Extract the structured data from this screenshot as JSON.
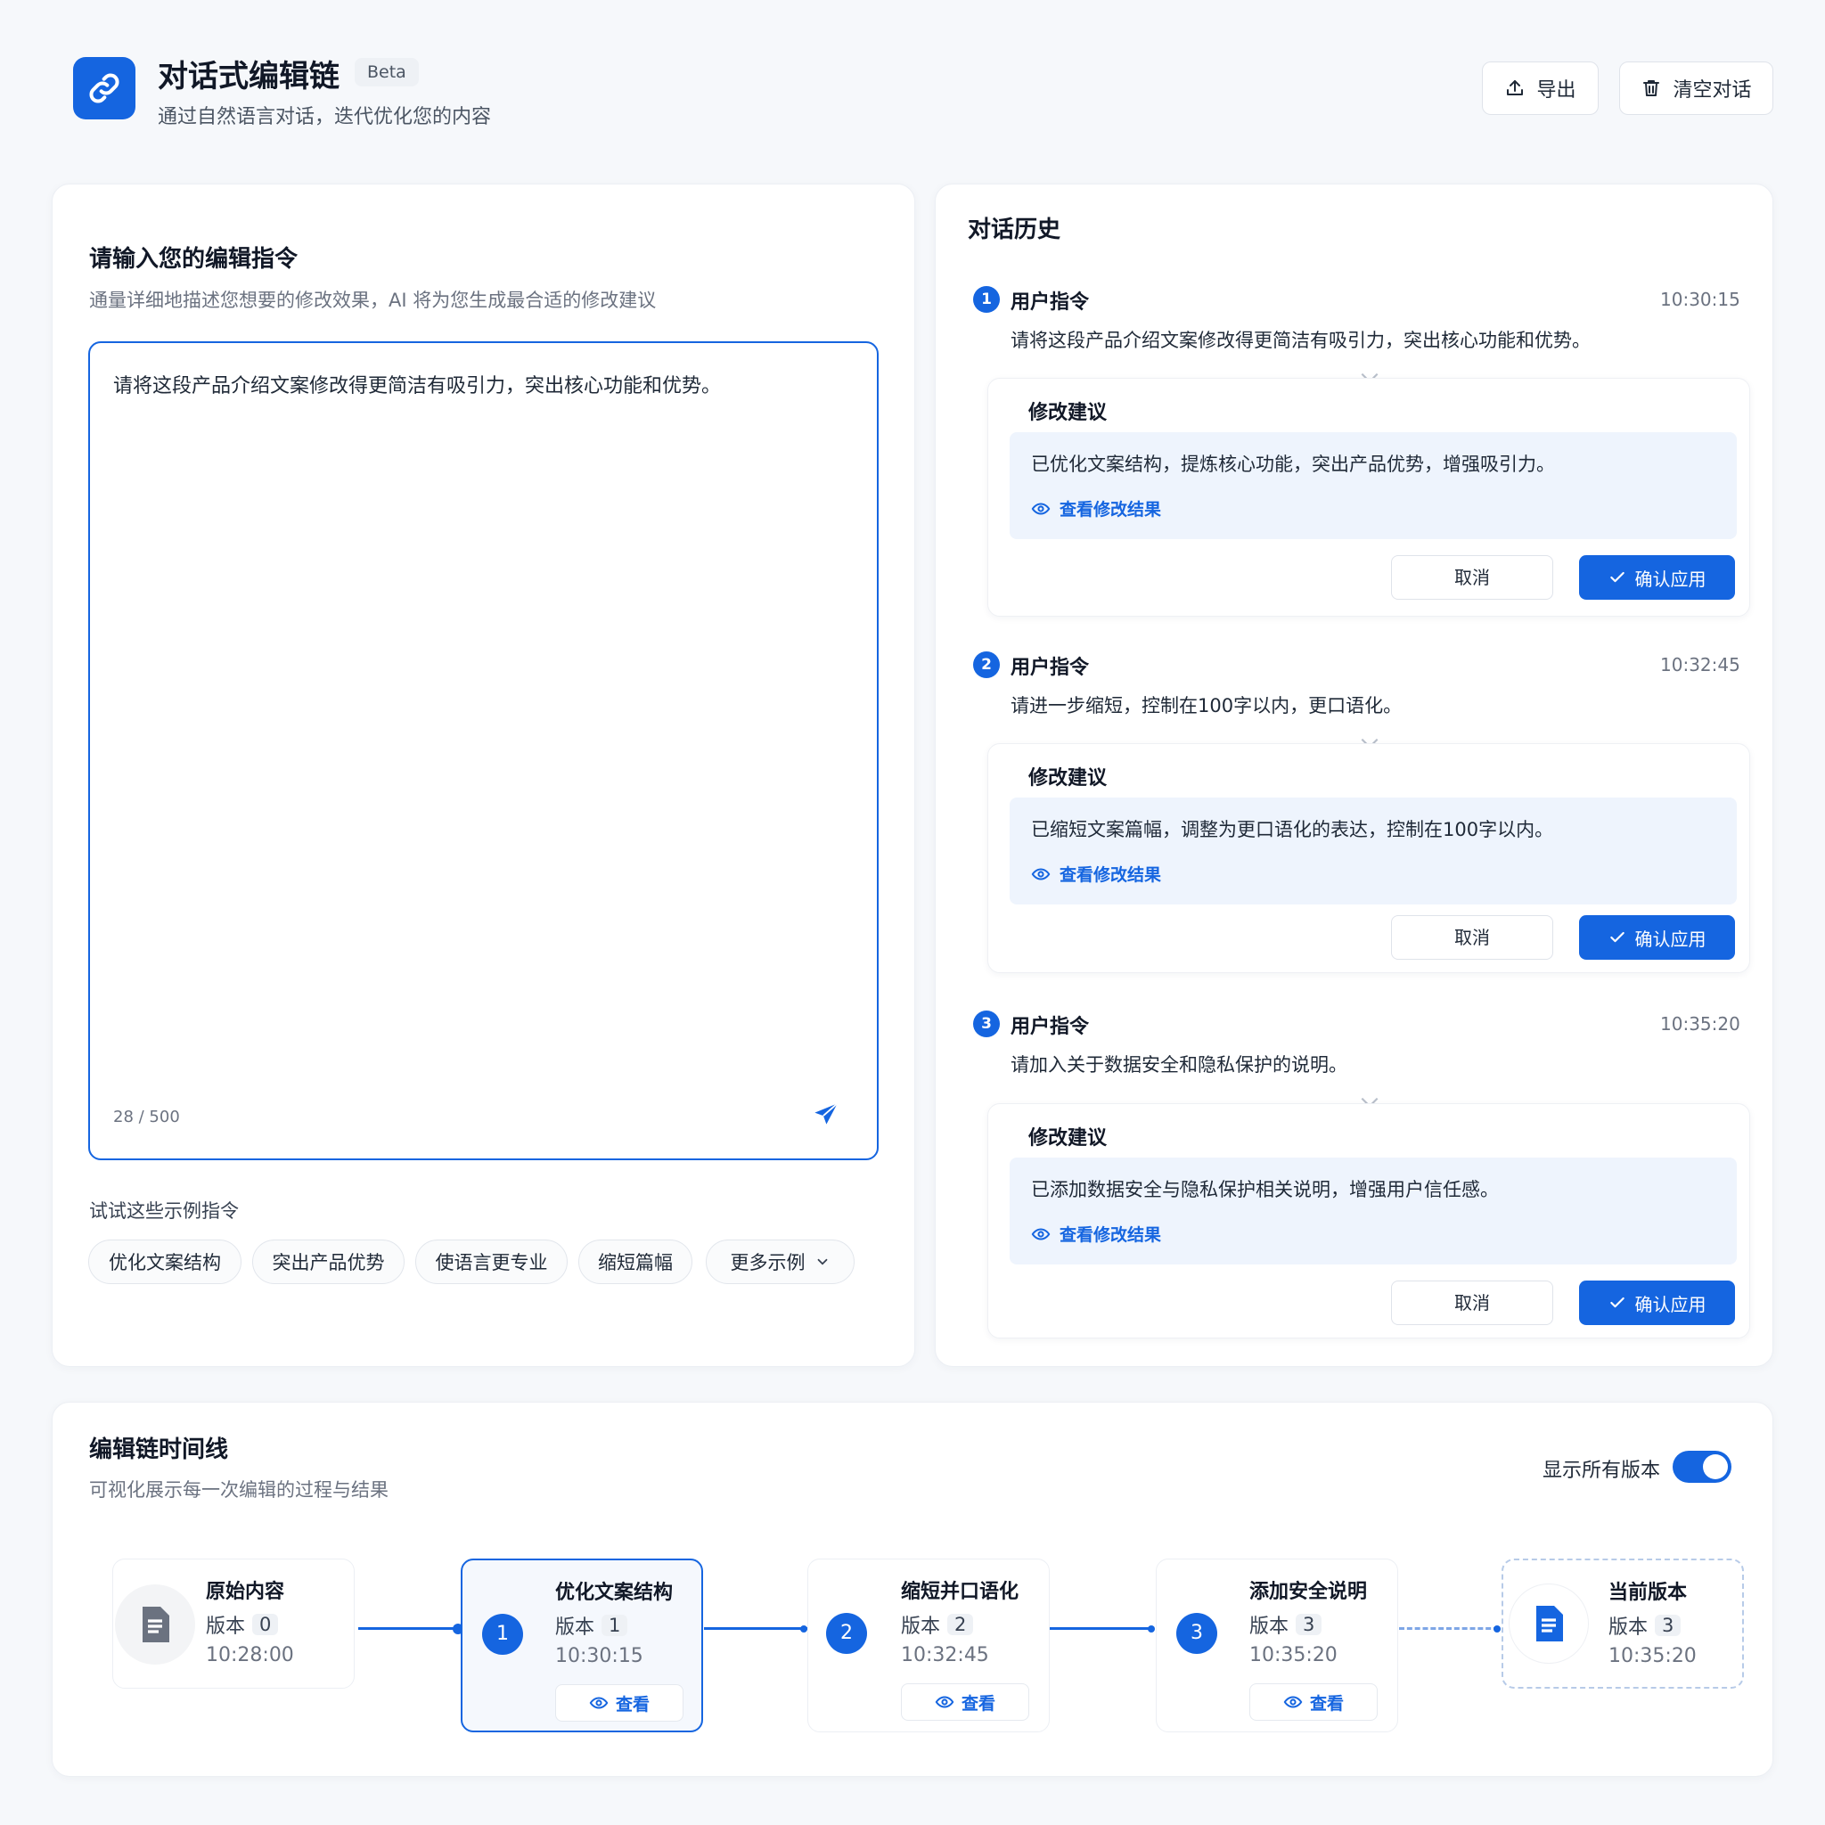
{
  "header": {
    "title": "对话式编辑链",
    "beta": "Beta",
    "subtitle": "通过自然语言对话，迭代优化您的内容",
    "export_label": "导出",
    "clear_label": "清空对话"
  },
  "input_panel": {
    "title": "请输入您的编辑指令",
    "subtitle": "通量详细地描述您想要的修改效果，AI 将为您生成最合适的修改建议",
    "text": "请将这段产品介绍文案修改得更简洁有吸引力，突出核心功能和优势。",
    "char_count": "28 / 500",
    "examples_label": "试试这些示例指令",
    "examples": [
      "优化文案结构",
      "突出产品优势",
      "使语言更专业",
      "缩短篇幅"
    ],
    "more_label": "更多示例"
  },
  "history": {
    "title": "对话历史",
    "items": [
      {
        "num": "1",
        "label": "用户指令",
        "time": "10:30:15",
        "command": "请将这段产品介绍文案修改得更简洁有吸引力，突出核心功能和优势。",
        "suggestion_title": "修改建议",
        "suggestion": "已优化文案结构，提炼核心功能，突出产品优势，增强吸引力。",
        "view_label": "查看修改结果",
        "cancel_label": "取消",
        "apply_label": "确认应用"
      },
      {
        "num": "2",
        "label": "用户指令",
        "time": "10:32:45",
        "command": "请进一步缩短，控制在100字以内，更口语化。",
        "suggestion_title": "修改建议",
        "suggestion": "已缩短文案篇幅，调整为更口语化的表达，控制在100字以内。",
        "view_label": "查看修改结果",
        "cancel_label": "取消",
        "apply_label": "确认应用"
      },
      {
        "num": "3",
        "label": "用户指令",
        "time": "10:35:20",
        "command": "请加入关于数据安全和隐私保护的说明。",
        "suggestion_title": "修改建议",
        "suggestion": "已添加数据安全与隐私保护相关说明，增强用户信任感。",
        "view_label": "查看修改结果",
        "cancel_label": "取消",
        "apply_label": "确认应用"
      }
    ]
  },
  "timeline": {
    "title": "编辑链时间线",
    "subtitle": "可视化展示每一次编辑的过程与结果",
    "toggle_label": "显示所有版本",
    "toggle_on": true,
    "version_prefix": "版本",
    "view_label": "查看",
    "nodes": [
      {
        "title": "原始内容",
        "version": "0",
        "time": "10:28:00"
      },
      {
        "num": "1",
        "title": "优化文案结构",
        "version": "1",
        "time": "10:30:15"
      },
      {
        "num": "2",
        "title": "缩短并口语化",
        "version": "2",
        "time": "10:32:45"
      },
      {
        "num": "3",
        "title": "添加安全说明",
        "version": "3",
        "time": "10:35:20"
      },
      {
        "title": "当前版本",
        "version": "3",
        "time": "10:35:20"
      }
    ]
  },
  "colors": {
    "accent": "#1565e0",
    "background": "#f6f8fb",
    "suggestion_bg": "#eef4fd"
  }
}
